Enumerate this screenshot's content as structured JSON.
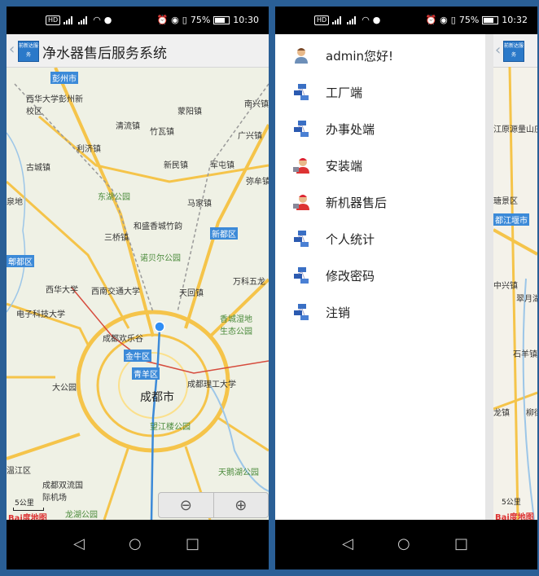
{
  "left_phone": {
    "status": {
      "battery": "75%",
      "time": "10:30"
    },
    "app_title": "净水器售后服务系统",
    "logo_text": "前新达服务",
    "map_labels": {
      "l1": "彭州市",
      "l2": "西华大学彭州新校区",
      "l3": "蒙阳镇",
      "l4": "南兴镇",
      "l5": "清流镇",
      "l6": "竹瓦镇",
      "l7": "广兴镇",
      "l8": "利济镇",
      "l9": "古城镇",
      "l10": "新民镇",
      "l11": "军屯镇",
      "l12": "弥牟镇",
      "l13": "东湖公园",
      "l14": "马家镇",
      "l15": "和盛香城竹韵",
      "l16": "新都区",
      "l17": "三桥镇",
      "l18": "诺贝尔公园",
      "l19": "万科五龙",
      "l20": "天回镇",
      "l21": "西华大学",
      "l22": "西南交通大学",
      "l23": "电子科技大学",
      "l24": "成都欢乐谷",
      "l25": "香城湿地生态公园",
      "l26": "金牛区",
      "l27": "青羊区",
      "l28": "大公园",
      "l29": "成都理工大学",
      "l30": "成都市",
      "l31": "望江楼公园",
      "l32": "天鹅湖公园",
      "l33": "成都双流国际机场",
      "l34": "龙湖公园",
      "l35": "郫都区",
      "l36": "泉地",
      "l37": "温江区"
    },
    "scale": "5公里",
    "baidu": "Bai度地图"
  },
  "right_phone": {
    "status": {
      "battery": "75%",
      "time": "10:32"
    },
    "logo_text": "前新达服务",
    "menu": [
      {
        "label": "admin您好!"
      },
      {
        "label": "工厂端"
      },
      {
        "label": "办事处端"
      },
      {
        "label": "安装端"
      },
      {
        "label": "新机器售后"
      },
      {
        "label": "个人统计"
      },
      {
        "label": "修改密码"
      },
      {
        "label": "注销"
      }
    ],
    "peek_labels": {
      "p1": "江原源量山庄",
      "p2": "瑭景区",
      "p3": "都江堰市",
      "p4": "中兴镇",
      "p5": "翠月湖",
      "p6": "石羊镇",
      "p7": "龙镇",
      "p8": "柳街"
    },
    "scale": "5公里",
    "baidu": "Bai度地图"
  },
  "colors": {
    "background": "#2a5f96",
    "road": "#f5c44a",
    "title_bar": "#f0f0f0"
  }
}
